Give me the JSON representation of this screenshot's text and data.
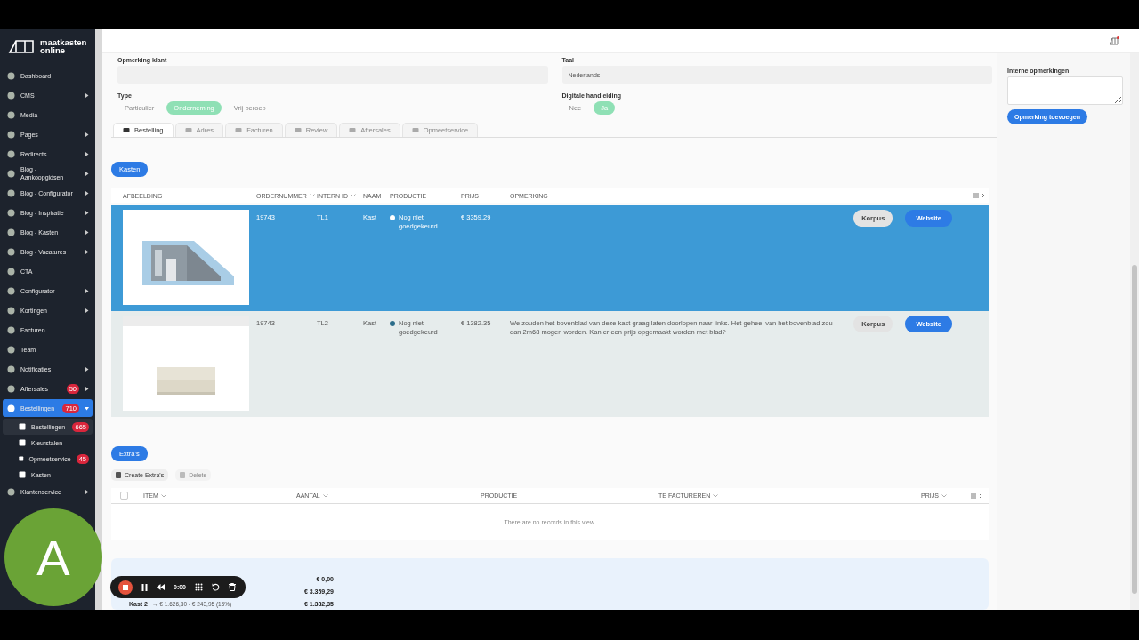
{
  "brand": {
    "line1": "maatkasten",
    "line2": "online"
  },
  "sidebar": {
    "items": [
      {
        "label": "Dashboard",
        "expandable": false,
        "selected": false
      },
      {
        "label": "CMS",
        "expandable": true,
        "selected": false
      },
      {
        "label": "Media",
        "expandable": false,
        "selected": false
      },
      {
        "label": "Pages",
        "expandable": true,
        "selected": false
      },
      {
        "label": "Redirects",
        "expandable": true,
        "selected": false
      },
      {
        "label": "Blog - Aankoopgidsen",
        "expandable": true,
        "selected": false
      },
      {
        "label": "Blog - Configurator",
        "expandable": true,
        "selected": false
      },
      {
        "label": "Blog - Inspiratie",
        "expandable": true,
        "selected": false
      },
      {
        "label": "Blog - Kasten",
        "expandable": true,
        "selected": false
      },
      {
        "label": "Blog - Vacatures",
        "expandable": true,
        "selected": false
      },
      {
        "label": "CTA",
        "expandable": false,
        "selected": false
      },
      {
        "label": "Configurator",
        "expandable": true,
        "selected": false
      },
      {
        "label": "Kortingen",
        "expandable": true,
        "selected": false
      },
      {
        "label": "Facturen",
        "expandable": false,
        "selected": false
      },
      {
        "label": "Team",
        "expandable": false,
        "selected": false
      },
      {
        "label": "Notificaties",
        "expandable": true,
        "selected": false
      },
      {
        "label": "Aftersales",
        "badge": "50",
        "expandable": true,
        "selected": false
      },
      {
        "label": "Bestellingen",
        "badge": "710",
        "expandable": true,
        "selected": true,
        "expanded": true,
        "children": [
          {
            "label": "Bestellingen",
            "badge": "665",
            "selected": true
          },
          {
            "label": "Kleurstalen",
            "selected": false
          },
          {
            "label": "Opmeetservice",
            "badge": "45",
            "selected": false
          },
          {
            "label": "Kasten",
            "selected": false
          }
        ]
      },
      {
        "label": "Klantenservice",
        "expandable": true,
        "selected": false
      }
    ]
  },
  "form": {
    "opmerking_klant": {
      "label": "Opmerking klant"
    },
    "taal": {
      "label": "Taal",
      "value": "Nederlands"
    },
    "type": {
      "label": "Type",
      "options": [
        {
          "label": "Particulier",
          "selected": false
        },
        {
          "label": "Onderneming",
          "selected": true
        },
        {
          "label": "Vrij beroep",
          "selected": false
        }
      ]
    },
    "digitale_handleiding": {
      "label": "Digitale handleiding",
      "options": [
        {
          "label": "Nee",
          "selected": false
        },
        {
          "label": "Ja",
          "selected": true
        }
      ]
    }
  },
  "tabs": [
    {
      "label": "Bestelling",
      "selected": true
    },
    {
      "label": "Adres",
      "selected": false
    },
    {
      "label": "Facturen",
      "selected": false
    },
    {
      "label": "Review",
      "selected": false
    },
    {
      "label": "Aftersales",
      "selected": false
    },
    {
      "label": "Opmeetservice",
      "selected": false
    }
  ],
  "kasten": {
    "button": "Kasten",
    "columns": [
      {
        "label": "AFBEELDING",
        "sortable": false
      },
      {
        "label": "ORDERNUMMER",
        "sortable": true
      },
      {
        "label": "INTERN ID",
        "sortable": true
      },
      {
        "label": "NAAM",
        "sortable": false
      },
      {
        "label": "PRODUCTIE",
        "sortable": false
      },
      {
        "label": "PRIJS",
        "sortable": false
      },
      {
        "label": "OPMERKING",
        "sortable": false
      }
    ],
    "rows": [
      {
        "selected": true,
        "ordernummer": "19743",
        "intern_id": "TL1",
        "naam": "Kast",
        "productie": "Nog niet goedgekeurd",
        "prijs": "€ 3359.29",
        "opmerking": "",
        "buttons": [
          "Korpus",
          "Website"
        ],
        "image": {
          "kind": "picture"
        }
      },
      {
        "selected": false,
        "ordernummer": "19743",
        "intern_id": "TL2",
        "naam": "Kast",
        "productie": "Nog niet goedgekeurd",
        "prijs": "€ 1382.35",
        "opmerking": "We zouden het bovenblad van deze kast graag laten doorlopen naar links. Het geheel van het bovenblad zou dan 2m68 mogen worden. Kan er een prijs opgemaakt worden met blad?",
        "buttons": [
          "Korpus",
          "Website"
        ],
        "image": {
          "kind": "picture"
        }
      }
    ]
  },
  "extras": {
    "button": "Extra's",
    "select_all": {
      "checked": false
    },
    "toolbar": [
      {
        "label": "Create Extra's",
        "disabled": false
      },
      {
        "label": "Delete",
        "disabled": true
      }
    ],
    "columns": [
      {
        "label": "ITEM",
        "sortable": true
      },
      {
        "label": "AANTAL",
        "sortable": true
      },
      {
        "label": "PRODUCTIE",
        "sortable": false
      },
      {
        "label": "TE FACTUREREN",
        "sortable": true
      },
      {
        "label": "PRIJS",
        "sortable": true
      }
    ],
    "empty": "There are no records in this view."
  },
  "summary": [
    {
      "value": "€ 0,00"
    },
    {
      "value": "€ 3.359,29"
    },
    {
      "label": "Kast 2",
      "note": "→ € 1.626,30 - € 243,95 (15%)",
      "value": "€ 1.382,35"
    }
  ],
  "internal": {
    "label": "Interne opmerkingen",
    "button": "Opmerking toevoegen"
  },
  "recorder": {
    "avatar": "A",
    "time": "0:00"
  }
}
